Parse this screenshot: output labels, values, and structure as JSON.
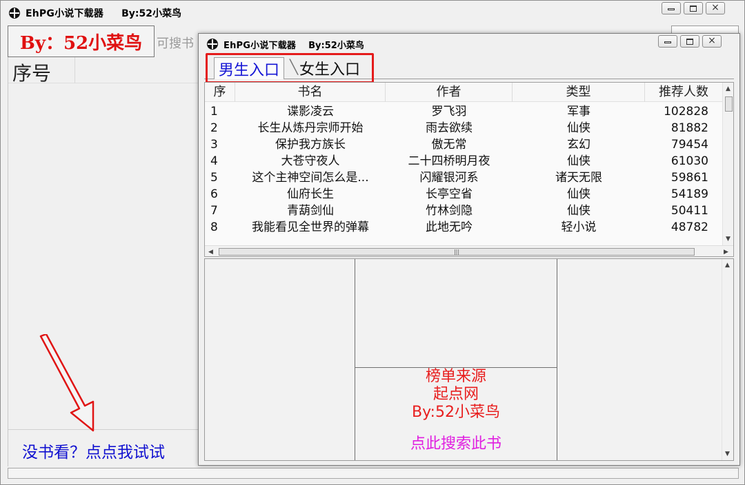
{
  "main_window": {
    "title": "EhPG小说下载器",
    "author": "By:52小菜鸟",
    "by_box": "By：52小菜鸟",
    "hint": "可搜书",
    "list_header": {
      "seq": "序号"
    },
    "try_link": "没书看？点点我试试"
  },
  "child_window": {
    "title": "EhPG小说下载器",
    "author": "By:52小菜鸟",
    "tabs": [
      {
        "label": "男生入口",
        "selected": true
      },
      {
        "label": "女生入口",
        "selected": false
      }
    ],
    "table": {
      "columns": [
        "序",
        "书名",
        "作者",
        "类型",
        "推荐人数"
      ],
      "rows": [
        [
          "1",
          "谍影凌云",
          "罗飞羽",
          "军事",
          "102828"
        ],
        [
          "2",
          "长生从炼丹宗师开始",
          "雨去欲续",
          "仙侠",
          "81882"
        ],
        [
          "3",
          "保护我方族长",
          "傲无常",
          "玄幻",
          "79454"
        ],
        [
          "4",
          "大苍守夜人",
          "二十四桥明月夜",
          "仙侠",
          "61030"
        ],
        [
          "5",
          "这个主神空间怎么是...",
          "闪耀银河系",
          "诸天无限",
          "59861"
        ],
        [
          "6",
          "仙府长生",
          "长亭空省",
          "仙侠",
          "54189"
        ],
        [
          "7",
          "青葫剑仙",
          "竹林剑隐",
          "仙侠",
          "50411"
        ],
        [
          "8",
          "我能看见全世界的弹幕",
          "此地无吟",
          "轻小说",
          "48782"
        ]
      ]
    },
    "info_panel": {
      "source_label": "榜单来源",
      "source_site": "起点网",
      "author": "By:52小菜鸟",
      "search_link": "点此搜索此书"
    }
  },
  "window_controls": {
    "close": "×"
  },
  "colors": {
    "highlight_red": "#e41b1b",
    "link_blue": "#1515d5",
    "link_magenta": "#e01fe0",
    "text_red": "#e81e1e"
  }
}
